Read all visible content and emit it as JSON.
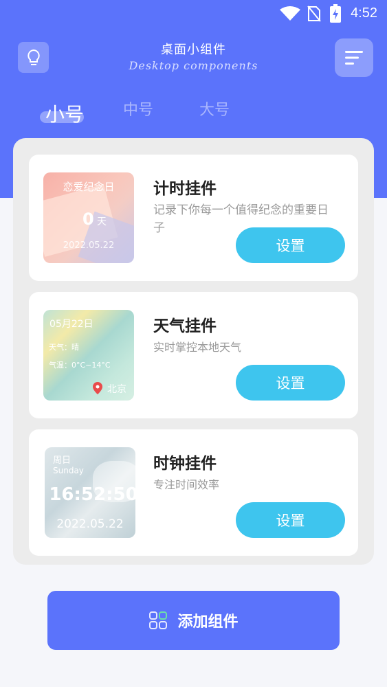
{
  "status_bar": {
    "time": "4:52"
  },
  "header": {
    "title": "桌面小组件",
    "subtitle": "Desktop components",
    "tabs": [
      {
        "label": "小号",
        "active": true
      },
      {
        "label": "中号",
        "active": false
      },
      {
        "label": "大号",
        "active": false
      }
    ]
  },
  "cards": [
    {
      "title": "计时挂件",
      "description": "记录下你每一个值得纪念的重要日子",
      "button": "设置",
      "preview": {
        "heading": "恋爱纪念日",
        "count": "0",
        "unit": "天",
        "date": "2022.05.22"
      }
    },
    {
      "title": "天气挂件",
      "description": "实时掌控本地天气",
      "button": "设置",
      "preview": {
        "date": "05月22日",
        "weather": "天气：晴",
        "temperature": "气温：0°C~14°C",
        "city": "北京"
      }
    },
    {
      "title": "时钟挂件",
      "description": "专注时间效率",
      "button": "设置",
      "preview": {
        "weekday_cn": "周日",
        "weekday_en": "Sunday",
        "time": "16:52:50",
        "date": "2022.05.22"
      }
    }
  ],
  "add_button": {
    "label": "添加组件",
    "icon": "widgets-icon"
  },
  "colors": {
    "primary": "#5b73fb",
    "button": "#3ec5ee",
    "panel": "#ececec"
  }
}
